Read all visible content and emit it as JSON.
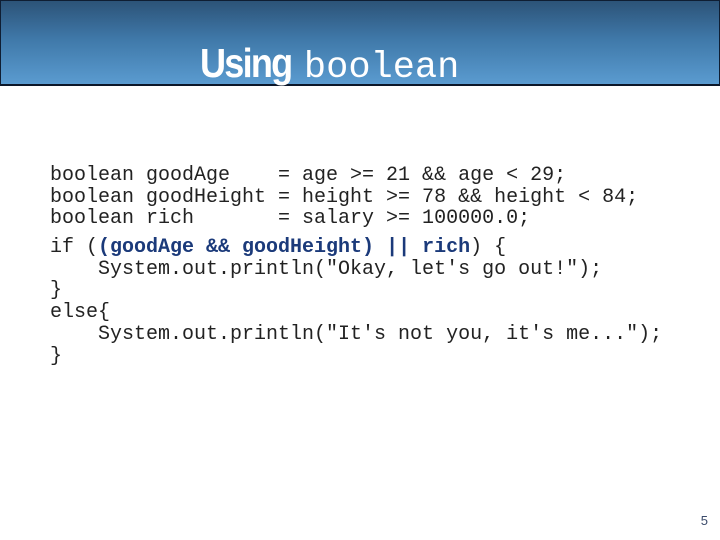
{
  "slide": {
    "title_word": "Using",
    "title_code": "boolean",
    "page_number": "5",
    "colors": {
      "header_top": "#2c5378",
      "header_bottom": "#5a9bd0",
      "highlight": "#1b3a7a",
      "text": "#222222"
    }
  },
  "code": {
    "declarations": [
      "boolean goodAge    = age >= 21 && age < 29;",
      "boolean goodHeight = height >= 78 && height < 84;",
      "boolean rich       = salary >= 100000.0;"
    ],
    "if_prefix": "if (",
    "if_condition": "(goodAge && goodHeight) || rich",
    "if_suffix": ") {",
    "body_lines": [
      "    System.out.println(\"Okay, let's go out!\");",
      "}",
      "else{",
      "    System.out.println(\"It's not you, it's me...\");",
      "}"
    ]
  }
}
